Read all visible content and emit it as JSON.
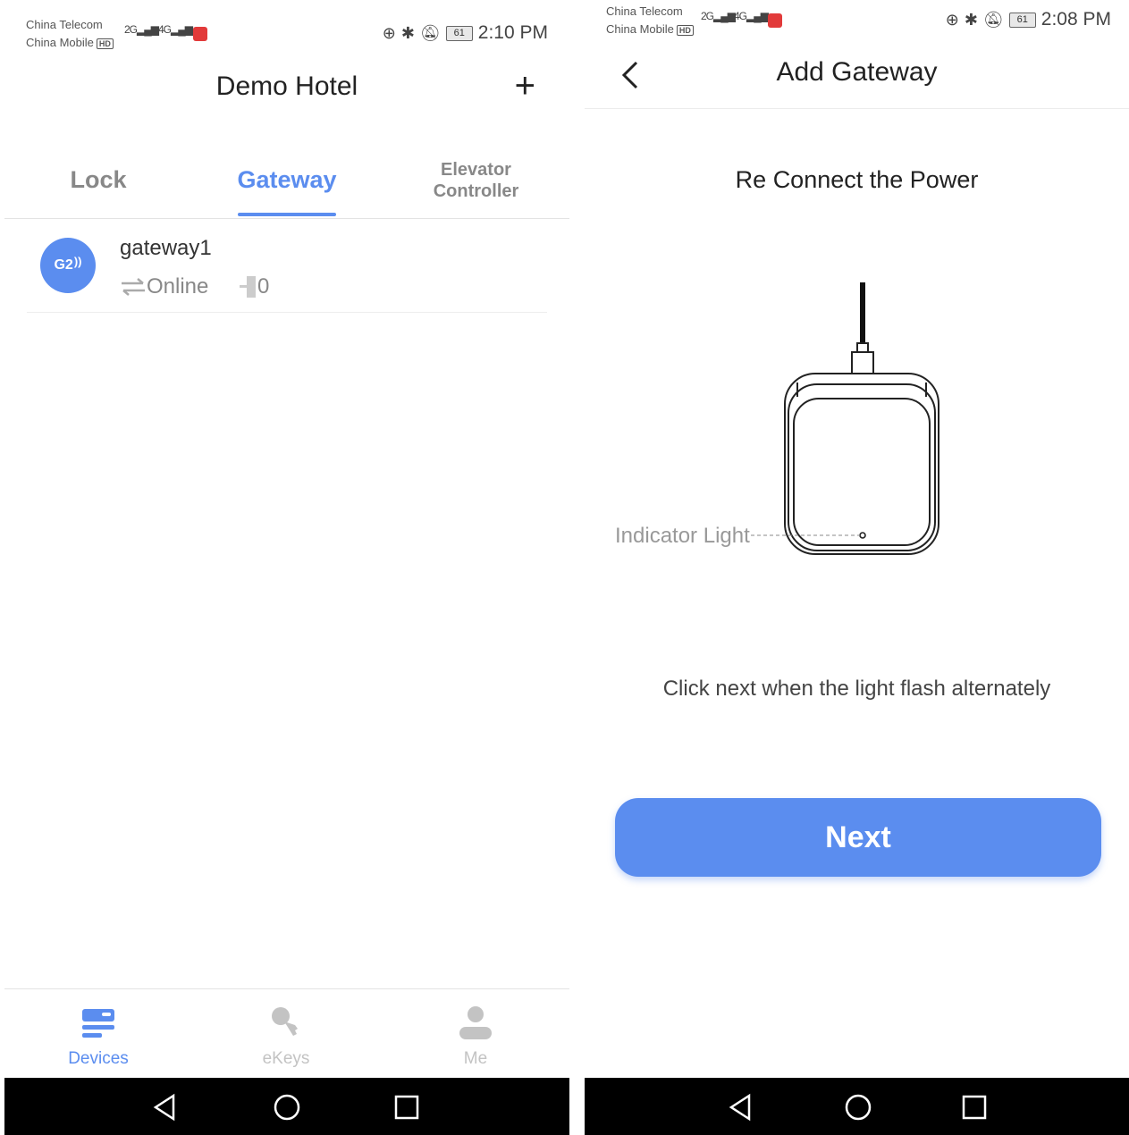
{
  "left": {
    "status": {
      "carrier1": "China Telecom",
      "carrier2": "China Mobile",
      "hd": "HD",
      "sig1": "2G",
      "sig2": "4G",
      "battery": "61",
      "time": "2:10 PM"
    },
    "title": "Demo Hotel",
    "add_icon": "plus-icon",
    "tabs": [
      {
        "label": "Lock"
      },
      {
        "label": "Gateway"
      },
      {
        "label_line1": "Elevator",
        "label_line2": "Controller"
      }
    ],
    "gateway_item": {
      "avatar_text": "G2",
      "name": "gateway1",
      "status": "Online",
      "lock_count": "0"
    },
    "nav": [
      {
        "label": "Devices",
        "icon": "devices-icon"
      },
      {
        "label": "eKeys",
        "icon": "key-icon"
      },
      {
        "label": "Me",
        "icon": "person-icon"
      }
    ]
  },
  "right": {
    "status": {
      "carrier1": "China Telecom",
      "carrier2": "China Mobile",
      "hd": "HD",
      "sig1": "2G",
      "sig2": "4G",
      "battery": "61",
      "time": "2:08 PM"
    },
    "title": "Add Gateway",
    "subtitle": "Re Connect the Power",
    "indicator_label": "Indicator Light",
    "instruction": "Click next when the light flash alternately",
    "next_label": "Next"
  },
  "colors": {
    "accent": "#5b8def",
    "inactive": "#c3c3c3",
    "text": "#333333"
  }
}
